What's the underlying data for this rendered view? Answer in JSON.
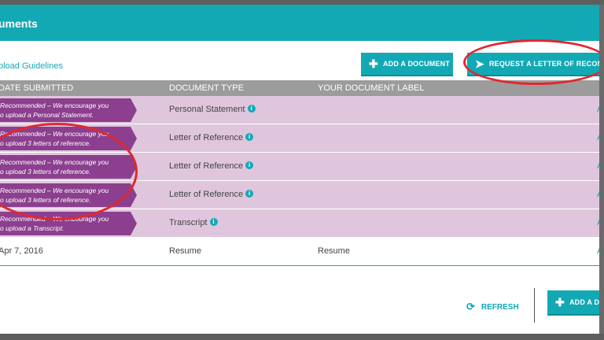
{
  "header": {
    "title": "uments"
  },
  "toolbar": {
    "guidelines_link": "pload Guidelines",
    "add_document_label": "ADD A DOCUMENT",
    "request_letter_label": "REQUEST A LETTER OF RECOMME"
  },
  "table": {
    "columns": [
      "DATE SUBMITTED",
      "DOCUMENT TYPE",
      "YOUR DOCUMENT LABEL"
    ],
    "rows": [
      {
        "flag_line1": "Recommended – We encourage you",
        "flag_line2": "o upload a Personal Statement.",
        "type": "Personal Statement",
        "info": "i",
        "action": "A"
      },
      {
        "flag_line1": "Recommended – We encourage you",
        "flag_line2": "o upload 3 letters of reference.",
        "type": "Letter of Reference",
        "info": "i",
        "action": "A"
      },
      {
        "flag_line1": "Recommended – We encourage you",
        "flag_line2": "o upload 3 letters of reference.",
        "type": "Letter of Reference",
        "info": "i",
        "action": "A"
      },
      {
        "flag_line1": "Recommended – We encourage you",
        "flag_line2": "o upload 3 letters of reference.",
        "type": "Letter of Reference",
        "info": "i",
        "action": "A"
      },
      {
        "flag_line1": "Recommended – We encourage you",
        "flag_line2": "o upload a Transcript.",
        "type": "Transcript",
        "info": "i",
        "action": "A"
      },
      {
        "date": "Apr 7, 2016",
        "type": "Resume",
        "label": "Resume",
        "action": "A"
      }
    ]
  },
  "footer": {
    "refresh_label": "REFRESH",
    "add_document_label": "ADD A DOC"
  },
  "icons": {
    "plus": "plus-icon",
    "send": "paper-plane-icon",
    "refresh": "refresh-icon",
    "info": "info-icon"
  },
  "colors": {
    "accent": "#12a9b5",
    "flag": "#8c3f8e",
    "row_highlight": "#dfc6dd",
    "annotation": "#e0282f"
  }
}
